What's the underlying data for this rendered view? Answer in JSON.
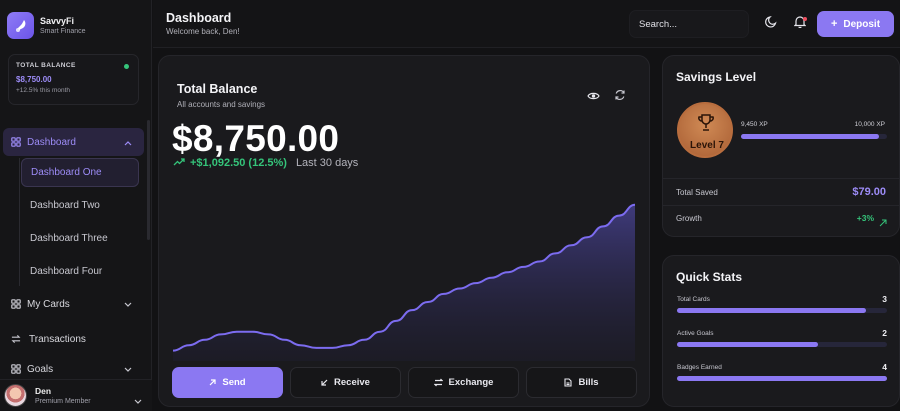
{
  "brand": {
    "name": "SavvyFi",
    "tagline": "Smart Finance"
  },
  "sidebar_balance": {
    "label": "TOTAL BALANCE",
    "value": "$8,750.00",
    "change": "+12.5% this month"
  },
  "nav": {
    "dashboard": "Dashboard",
    "sub_items": [
      "Dashboard One",
      "Dashboard Two",
      "Dashboard Three",
      "Dashboard Four"
    ],
    "my_cards": "My Cards",
    "transactions": "Transactions",
    "goals": "Goals"
  },
  "user": {
    "name": "Den",
    "role": "Premium Member"
  },
  "header": {
    "title": "Dashboard",
    "subtitle": "Welcome back, Den!",
    "search_placeholder": "Search...",
    "deposit_label": "Deposit"
  },
  "balance_card": {
    "title": "Total Balance",
    "subtitle": "All accounts and savings",
    "amount": "$8,750.00",
    "change": "+$1,092.50 (12.5%)",
    "period": "Last 30 days"
  },
  "actions": {
    "send": "Send",
    "receive": "Receive",
    "exchange": "Exchange",
    "bills": "Bills"
  },
  "savings": {
    "title": "Savings Level",
    "level": "Level 7",
    "xp_current": "9,450 XP",
    "xp_target": "10,000 XP",
    "xp_progress": 0.945,
    "total_saved_label": "Total Saved",
    "total_saved_value": "$79.00",
    "growth_label": "Growth",
    "growth_value": "+3%"
  },
  "quick_stats": {
    "title": "Quick Stats",
    "items": [
      {
        "label": "Total Cards",
        "value": "3",
        "progress": 0.9
      },
      {
        "label": "Active Goals",
        "value": "2",
        "progress": 0.67
      },
      {
        "label": "Badges Earned",
        "value": "4",
        "progress": 1.0
      }
    ]
  },
  "colors": {
    "accent": "#8b78f2",
    "positive": "#35c47a",
    "background": "#121214",
    "card": "#1a1a1d"
  },
  "chart_data": {
    "type": "area",
    "x": [
      0,
      1,
      2,
      3,
      4,
      5,
      6,
      7,
      8,
      9,
      10,
      11,
      12,
      13,
      14,
      15,
      16,
      17,
      18,
      19,
      20,
      21,
      22,
      23,
      24,
      25,
      26,
      27,
      28,
      29
    ],
    "values": [
      6.2,
      6.4,
      6.6,
      6.8,
      6.9,
      6.9,
      6.8,
      6.6,
      6.4,
      6.3,
      6.3,
      6.4,
      6.6,
      6.9,
      7.3,
      7.7,
      8.0,
      8.3,
      8.5,
      8.7,
      8.9,
      9.1,
      9.3,
      9.5,
      9.8,
      10.1,
      10.4,
      10.8,
      11.2,
      11.6
    ],
    "ylim": [
      6,
      12
    ],
    "grid": false,
    "xlabel": "",
    "ylabel": ""
  }
}
